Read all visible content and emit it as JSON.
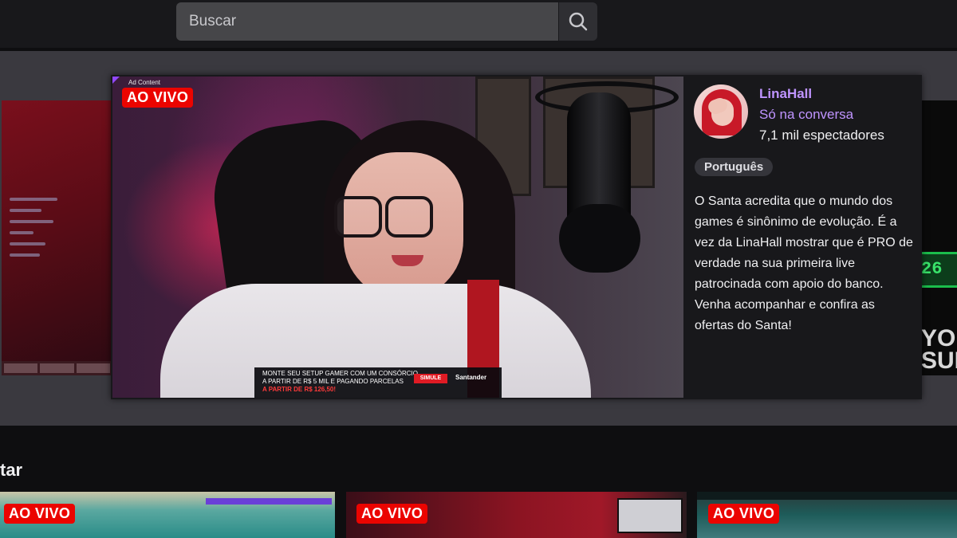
{
  "search": {
    "placeholder": "Buscar"
  },
  "featured": {
    "ad_label": "Ad Content",
    "live_badge": "AO VIVO",
    "channel_name": "LinaHall",
    "category": "Só na conversa",
    "viewers": "7,1 mil espectadores",
    "tag": "Português",
    "description": "O Santa acredita que o mundo dos games é sinônimo de evolução. É a vez da LinaHall mostrar que é PRO de verdade na sua primeira live patrocinada com apoio do banco. Venha acompanhar e confira as ofertas do Santa!",
    "overlay": {
      "line1": "MONTE SEU SETUP GAMER COM UM CONSÓRCIO",
      "line2": "A PARTIR DE R$ 5 MIL E PAGANDO PARCELAS",
      "line3": "A PARTIR DE R$ 126,50!",
      "button": "SIMULE",
      "brand": "Santander"
    }
  },
  "side_right": {
    "timer_text": "26",
    "big_text_1": "YO",
    "big_text_2": "SUM"
  },
  "section": {
    "title": "tar"
  },
  "thumbnails": [
    {
      "live_badge": "AO VIVO"
    },
    {
      "live_badge": "AO VIVO"
    },
    {
      "live_badge": "AO VIVO"
    }
  ],
  "colors": {
    "accent": "#bf94ff",
    "live": "#eb0400",
    "background": "#0e0e10",
    "band": "#3a393f"
  },
  "icons": {
    "search": "search-icon"
  }
}
